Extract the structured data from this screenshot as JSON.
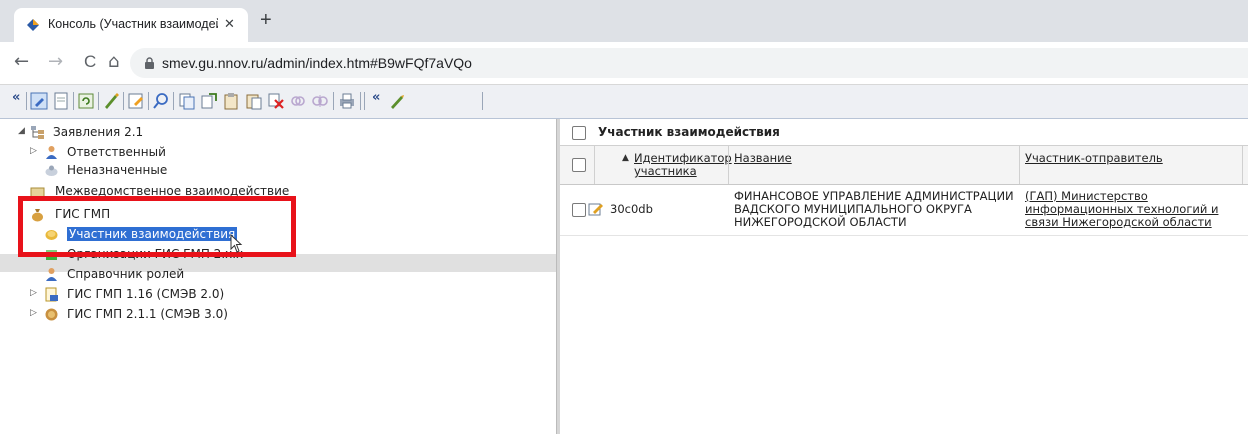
{
  "browser": {
    "tab_title": "Консоль (Участник взаимодействия",
    "tab_close": "✕",
    "new_tab": "+",
    "url": "smev.gu.nnov.ru/admin/index.htm#B9wFQf7aVQo",
    "nav": {
      "back": "←",
      "forward": "→",
      "reload": "C",
      "home": "⌂"
    }
  },
  "toolbar": {
    "collapse_label": "«",
    "collapse2_label": "«"
  },
  "tree": {
    "nodes": [
      {
        "label": "Заявления 2.1"
      },
      {
        "label": "Ответственный"
      },
      {
        "label": "Неназначенные"
      },
      {
        "label": "Межведомственное взаимодействие"
      },
      {
        "label": "ГИС ГМП"
      },
      {
        "label": "Участник взаимодействия"
      },
      {
        "label": "Организации ГИС ГМП 2.х.х"
      },
      {
        "label": "Справочник ролей"
      },
      {
        "label": "ГИС ГМП 1.16 (СМЭВ 2.0)"
      },
      {
        "label": "ГИС ГМП 2.1.1 (СМЭВ 3.0)"
      }
    ]
  },
  "grid": {
    "title": "Участник взаимодействия",
    "columns": [
      {
        "label": "Идентификатор участника"
      },
      {
        "label": "Название"
      },
      {
        "label": "Участник-отправитель"
      }
    ],
    "rows": [
      {
        "id": "30c0db",
        "name": "ФИНАНСОВОЕ УПРАВЛЕНИЕ АДМИНИСТРАЦИИ ВАДСКОГО МУНИЦИПАЛЬНОГО ОКРУГА НИЖЕГОРОДСКОЙ ОБЛАСТИ",
        "sender": "(ГАП) Министерство информационных технологий и связи Нижегородской области"
      }
    ]
  },
  "colors": {
    "highlight": "#e8121a",
    "selection": "#2f6fd3",
    "toolbar_bg": "#eef0f4"
  }
}
